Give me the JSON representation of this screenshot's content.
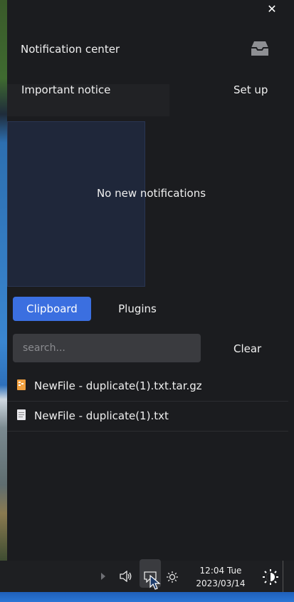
{
  "panel": {
    "title": "Notification center",
    "important_label": "Important notice",
    "setup_label": "Set up",
    "empty_message": "No new notifications"
  },
  "tabs": [
    {
      "label": "Clipboard",
      "active": true
    },
    {
      "label": "Plugins",
      "active": false
    }
  ],
  "clipboard": {
    "search_placeholder": "search...",
    "clear_label": "Clear",
    "items": [
      {
        "name": "NewFile - duplicate(1).txt.tar.gz",
        "icon": "archive-file-icon"
      },
      {
        "name": "NewFile - duplicate(1).txt",
        "icon": "text-file-icon"
      }
    ]
  },
  "taskbar": {
    "time": "12:04 Tue",
    "date": "2023/03/14"
  },
  "colors": {
    "accent": "#3b6fe0",
    "panel_bg": "#1b1c1f",
    "field_bg": "#3a3b3f"
  }
}
